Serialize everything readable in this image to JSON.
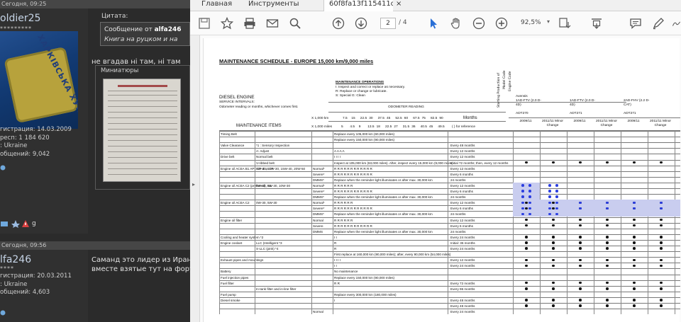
{
  "forum": {
    "post1": {
      "timestamp": "Сегодня, 09:25",
      "username": "oldier25",
      "stars": "*********",
      "avatar_text": "ХАРКІВСЬКА ХУНТА",
      "info": [
        "гистрация: 14.03.2009",
        "респ: 1 184 620",
        ": Ukraine",
        "общений: 9,042"
      ],
      "quote_label": "Цитата:",
      "quote_line1_prefix": "Сообщение от ",
      "quote_author": "alfa246",
      "quote_line2": "Книга на руцком и на",
      "text": "не вгадав ні там, ні там",
      "attachments_label": "Миниатюры"
    },
    "post2": {
      "timestamp": "Сегодня, 09:56",
      "username": "lfa246",
      "stars": "****",
      "info": [
        "гистрация: 20.03.2011",
        ": Ukraine",
        "общений: 4,603"
      ],
      "text_line1": "Саманд это лидер из Иран",
      "text_line2": "вместе взятые тут на фору"
    },
    "icon_badge": "g"
  },
  "viewer": {
    "tabs": [
      {
        "label": "Главная"
      },
      {
        "label": "Инструменты"
      },
      {
        "label": "60f8fa13f115411ca..."
      }
    ],
    "tab_close": "×",
    "page_current": "2",
    "page_total": "/ 4",
    "zoom": "92,5%",
    "zoom_arrow": "▾",
    "side_arrow": "▸"
  },
  "document": {
    "title": "MAINTENANCE SCHEDULE - EUROPE 15,000 km/9,000 miles",
    "ops_heading": "MAINTENANCE OPERATIONS",
    "ops_lines": [
      "I: Inspect and correct or replace as necessary.",
      "R: Replace or change or lubricate.",
      "S: Special     G: Clean"
    ],
    "engine": "DIESEL ENGINE",
    "service_intervals": "SERVICE INTERVALS:",
    "odo_note": "Odometer reading or months, whichever comes first.",
    "odo_heading": "ODOMETER READING",
    "months": "Months",
    "for_reference": "( ) for reference",
    "maint_items": "MAINTENANCE ITEMS",
    "x1000km": "X 1,000 km",
    "x1000mi": "X 1,000 miles",
    "km_values": [
      "7.5",
      "15",
      "22.5",
      "30",
      "37.5",
      "45",
      "52.5",
      "60",
      "67.5",
      "75",
      "82.5",
      "90"
    ],
    "mi_values": [
      "5",
      "4.5",
      "9",
      "13.5",
      "18",
      "22.5",
      "27",
      "31.5",
      "36",
      "40.5",
      "45",
      "49.5",
      "54"
    ],
    "vertical_labels": [
      "Starting Production of",
      "Model Code",
      "Engine Code"
    ],
    "models": [
      {
        "engine": "Avensis",
        "code": "ADT270"
      },
      {
        "engine": "1AD-FTV (2.0 D-4D)",
        "code": "ADT271"
      },
      {
        "engine": "2AD-FHV (2.2 D-CAT)",
        "code": "ADT271"
      }
    ],
    "col_dates": [
      "2009/11",
      "2011/11 Minor Change",
      "2009/11",
      "2011/11 Minor Change",
      "2009/11",
      "2011/11 Minor Change"
    ],
    "rows": [
      {
        "item": "Timing Belt",
        "sub": "",
        "mode": "",
        "text": "Replace every 105,000 km (60,000 miles)",
        "mo": ""
      },
      {
        "item": "",
        "sub": "",
        "mode": "",
        "text": "Replace every 150,000 km (90,000 miles)",
        "mo": ""
      },
      {
        "item": "Valve Clearance",
        "sub": "*1 : Sensory Inspection",
        "mode": "",
        "text": "",
        "mo": "Every 48 months"
      },
      {
        "item": "",
        "sub": "A: Adjust",
        "mode": "",
        "text": "A   A   A   A",
        "mo": "Every 12 months"
      },
      {
        "item": "Drive belt",
        "sub": "Normal belt",
        "mode": "",
        "text": "I   I   I   I",
        "mo": "Every 12 months"
      },
      {
        "item": "",
        "sub": "V-ribbed belt",
        "mode": "",
        "text": "Inspect at 105,000 km (63,000 miles). After, inspect every 15,000 km (9,000 miles)",
        "mo": "Initial 72 months; then, every 12 months"
      },
      {
        "item": "Engine oil ACEA B1 API: CF-4 or CF",
        "sub": "5W-30, 10W-30, 15W-40, 20W-50",
        "mode": "Normal*",
        "text": "R R R R R R R R R R R R",
        "mo": "Every 12 months"
      },
      {
        "item": "",
        "sub": "",
        "mode": "Severe*",
        "text": "R R R R R R R R R R R R",
        "mo": "Every 6 months"
      },
      {
        "item": "",
        "sub": "",
        "mode": "DMMS*",
        "text": "Replace when the reminder light illuminates or after max. 30,000 km",
        "mo": "24 months"
      },
      {
        "item": "Engine oil ACEA C2 (preferred), B1",
        "sub": "0W-30, 5W-30, 10W-30",
        "mode": "Normal*",
        "text": "R R R R R R",
        "mo": "Every 12 months"
      },
      {
        "item": "",
        "sub": "",
        "mode": "Severe*",
        "text": "R R R R R R R R R R R R",
        "mo": "Every 6 months"
      },
      {
        "item": "",
        "sub": "",
        "mode": "DMMS*",
        "text": "Replace when the reminder light illuminates or after max. 30,000 km",
        "mo": "24 months"
      },
      {
        "item": "Engine oil ACEA C2",
        "sub": "0W-30, 5W-30",
        "mode": "Normal*",
        "text": "R R R R R R",
        "mo": "Every 12 months"
      },
      {
        "item": "",
        "sub": "",
        "mode": "Severe*",
        "text": "R R R R R R R R R R R R",
        "mo": "Every 6 months"
      },
      {
        "item": "",
        "sub": "",
        "mode": "DMMS*",
        "text": "Replace when the reminder light illuminates or after max. 30,000 km",
        "mo": "24 months"
      },
      {
        "item": "Engine oil filter",
        "sub": "",
        "mode": "Normal",
        "text": "R R R R R R",
        "mo": "Every 12 months"
      },
      {
        "item": "",
        "sub": "",
        "mode": "Severe",
        "text": "R R R R R R R R R R R R",
        "mo": "Every 6 months"
      },
      {
        "item": "",
        "sub": "",
        "mode": "DMMS",
        "text": "Replace when the reminder light illuminates or after max. 30,000 km",
        "mo": "24 months"
      },
      {
        "item": "Cooling and heater system *2",
        "sub": "",
        "mode": "",
        "text": "I   I",
        "mo": "Every 24 months"
      },
      {
        "item": "Engine coolant",
        "sub": "LLC (Intelligent *3",
        "mode": "",
        "text": "R",
        "mo": "Initial: 36 months"
      },
      {
        "item": "",
        "sub": "S-LLC (pink) *4",
        "mode": "",
        "text": "R",
        "mo": "Every 24 months"
      },
      {
        "item": "",
        "sub": "",
        "mode": "",
        "text": "First replace at 160,000 km (90,000 miles); after, every 90,000 km (54,000 miles)",
        "mo": ""
      },
      {
        "item": "Exhaust pipes and mountings",
        "sub": "",
        "mode": "",
        "text": "I   I   I   I",
        "mo": "Every 12 months"
      },
      {
        "item": "",
        "sub": "",
        "mode": "",
        "text": "I   I",
        "mo": "Every 24 months"
      },
      {
        "item": "Battery",
        "sub": "",
        "mode": "",
        "text": "No maintenance",
        "mo": ""
      },
      {
        "item": "Fuel injection pipes",
        "sub": "",
        "mode": "",
        "text": "Replace every 150,000 km (90,000 miles)",
        "mo": ""
      },
      {
        "item": "Fuel filter",
        "sub": "",
        "mode": "",
        "text": "R   R",
        "mo": "Every 72 months"
      },
      {
        "item": "",
        "sub": "In-tank filter and in-line filter",
        "mode": "",
        "text": "",
        "mo": "Every 96 months"
      },
      {
        "item": "Fuel pump",
        "sub": "",
        "mode": "",
        "text": "Replace every 300,000 km (180,000 miles)",
        "mo": ""
      },
      {
        "item": "Diesel smoke",
        "sub": "",
        "mode": "",
        "text": "I",
        "mo": "Every 48 months"
      },
      {
        "item": "",
        "sub": "",
        "mode": "",
        "text": "",
        "mo": "Every 48 months"
      },
      {
        "item": "",
        "sub": "",
        "mode": "Normal",
        "text": "",
        "mo": "Every 24 months"
      }
    ]
  }
}
